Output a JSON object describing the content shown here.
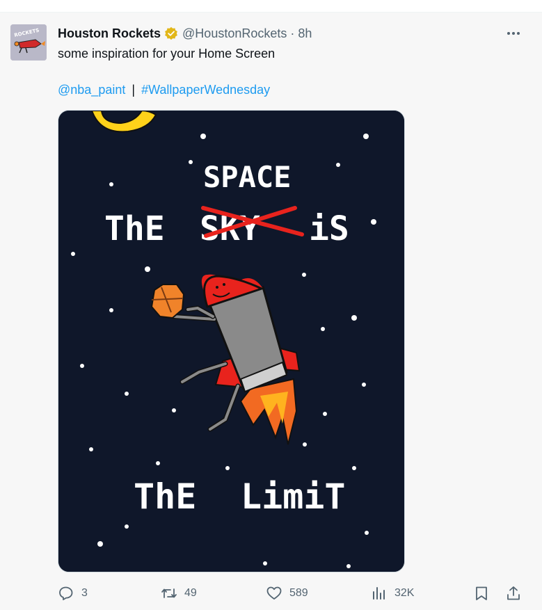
{
  "tweet": {
    "author_name": "Houston Rockets",
    "handle": "@HoustonRockets",
    "separator": "·",
    "time": "8h",
    "text": "some inspiration for your Home Screen",
    "tag_1": "@nba_paint",
    "tag_sep": "|",
    "tag_2": "#WallpaperWednesday"
  },
  "avatar": {
    "logo_text": "ROCKETS"
  },
  "media": {
    "line_1": "SPACE",
    "line_2_left": "ThE",
    "line_2_crossed": "SKY",
    "line_2_right": "iS",
    "line_3_left": "ThE",
    "line_3_right": "LimiT"
  },
  "actions": {
    "replies": "3",
    "reposts": "49",
    "likes": "589",
    "views": "32K"
  },
  "colors": {
    "accent": "#1d9bf0",
    "verified_badge": "#e2b719",
    "muted": "#536471",
    "media_background": "#0f172a",
    "rocket_red": "#e8231d"
  },
  "icons": {
    "verified": "verified-badge-icon",
    "more": "more-horizontal-icon",
    "reply": "reply-icon",
    "repost": "repost-icon",
    "like": "heart-icon",
    "views": "views-chart-icon",
    "bookmark": "bookmark-icon",
    "share": "share-icon"
  }
}
